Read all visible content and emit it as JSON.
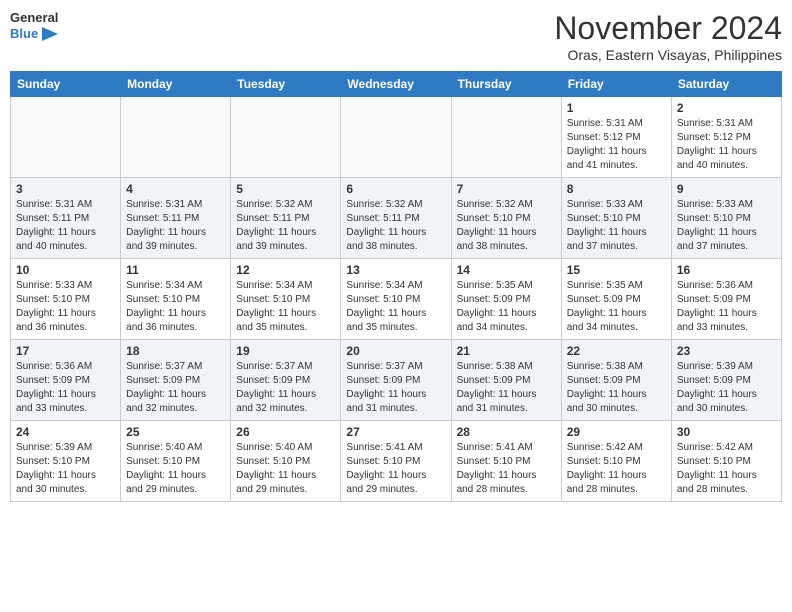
{
  "header": {
    "logo_line1": "General",
    "logo_line2": "Blue",
    "title": "November 2024",
    "subtitle": "Oras, Eastern Visayas, Philippines"
  },
  "calendar": {
    "days_of_week": [
      "Sunday",
      "Monday",
      "Tuesday",
      "Wednesday",
      "Thursday",
      "Friday",
      "Saturday"
    ],
    "weeks": [
      {
        "alt": false,
        "days": [
          {
            "num": "",
            "info": ""
          },
          {
            "num": "",
            "info": ""
          },
          {
            "num": "",
            "info": ""
          },
          {
            "num": "",
            "info": ""
          },
          {
            "num": "",
            "info": ""
          },
          {
            "num": "1",
            "info": "Sunrise: 5:31 AM\nSunset: 5:12 PM\nDaylight: 11 hours\nand 41 minutes."
          },
          {
            "num": "2",
            "info": "Sunrise: 5:31 AM\nSunset: 5:12 PM\nDaylight: 11 hours\nand 40 minutes."
          }
        ]
      },
      {
        "alt": true,
        "days": [
          {
            "num": "3",
            "info": "Sunrise: 5:31 AM\nSunset: 5:11 PM\nDaylight: 11 hours\nand 40 minutes."
          },
          {
            "num": "4",
            "info": "Sunrise: 5:31 AM\nSunset: 5:11 PM\nDaylight: 11 hours\nand 39 minutes."
          },
          {
            "num": "5",
            "info": "Sunrise: 5:32 AM\nSunset: 5:11 PM\nDaylight: 11 hours\nand 39 minutes."
          },
          {
            "num": "6",
            "info": "Sunrise: 5:32 AM\nSunset: 5:11 PM\nDaylight: 11 hours\nand 38 minutes."
          },
          {
            "num": "7",
            "info": "Sunrise: 5:32 AM\nSunset: 5:10 PM\nDaylight: 11 hours\nand 38 minutes."
          },
          {
            "num": "8",
            "info": "Sunrise: 5:33 AM\nSunset: 5:10 PM\nDaylight: 11 hours\nand 37 minutes."
          },
          {
            "num": "9",
            "info": "Sunrise: 5:33 AM\nSunset: 5:10 PM\nDaylight: 11 hours\nand 37 minutes."
          }
        ]
      },
      {
        "alt": false,
        "days": [
          {
            "num": "10",
            "info": "Sunrise: 5:33 AM\nSunset: 5:10 PM\nDaylight: 11 hours\nand 36 minutes."
          },
          {
            "num": "11",
            "info": "Sunrise: 5:34 AM\nSunset: 5:10 PM\nDaylight: 11 hours\nand 36 minutes."
          },
          {
            "num": "12",
            "info": "Sunrise: 5:34 AM\nSunset: 5:10 PM\nDaylight: 11 hours\nand 35 minutes."
          },
          {
            "num": "13",
            "info": "Sunrise: 5:34 AM\nSunset: 5:10 PM\nDaylight: 11 hours\nand 35 minutes."
          },
          {
            "num": "14",
            "info": "Sunrise: 5:35 AM\nSunset: 5:09 PM\nDaylight: 11 hours\nand 34 minutes."
          },
          {
            "num": "15",
            "info": "Sunrise: 5:35 AM\nSunset: 5:09 PM\nDaylight: 11 hours\nand 34 minutes."
          },
          {
            "num": "16",
            "info": "Sunrise: 5:36 AM\nSunset: 5:09 PM\nDaylight: 11 hours\nand 33 minutes."
          }
        ]
      },
      {
        "alt": true,
        "days": [
          {
            "num": "17",
            "info": "Sunrise: 5:36 AM\nSunset: 5:09 PM\nDaylight: 11 hours\nand 33 minutes."
          },
          {
            "num": "18",
            "info": "Sunrise: 5:37 AM\nSunset: 5:09 PM\nDaylight: 11 hours\nand 32 minutes."
          },
          {
            "num": "19",
            "info": "Sunrise: 5:37 AM\nSunset: 5:09 PM\nDaylight: 11 hours\nand 32 minutes."
          },
          {
            "num": "20",
            "info": "Sunrise: 5:37 AM\nSunset: 5:09 PM\nDaylight: 11 hours\nand 31 minutes."
          },
          {
            "num": "21",
            "info": "Sunrise: 5:38 AM\nSunset: 5:09 PM\nDaylight: 11 hours\nand 31 minutes."
          },
          {
            "num": "22",
            "info": "Sunrise: 5:38 AM\nSunset: 5:09 PM\nDaylight: 11 hours\nand 30 minutes."
          },
          {
            "num": "23",
            "info": "Sunrise: 5:39 AM\nSunset: 5:09 PM\nDaylight: 11 hours\nand 30 minutes."
          }
        ]
      },
      {
        "alt": false,
        "days": [
          {
            "num": "24",
            "info": "Sunrise: 5:39 AM\nSunset: 5:10 PM\nDaylight: 11 hours\nand 30 minutes."
          },
          {
            "num": "25",
            "info": "Sunrise: 5:40 AM\nSunset: 5:10 PM\nDaylight: 11 hours\nand 29 minutes."
          },
          {
            "num": "26",
            "info": "Sunrise: 5:40 AM\nSunset: 5:10 PM\nDaylight: 11 hours\nand 29 minutes."
          },
          {
            "num": "27",
            "info": "Sunrise: 5:41 AM\nSunset: 5:10 PM\nDaylight: 11 hours\nand 29 minutes."
          },
          {
            "num": "28",
            "info": "Sunrise: 5:41 AM\nSunset: 5:10 PM\nDaylight: 11 hours\nand 28 minutes."
          },
          {
            "num": "29",
            "info": "Sunrise: 5:42 AM\nSunset: 5:10 PM\nDaylight: 11 hours\nand 28 minutes."
          },
          {
            "num": "30",
            "info": "Sunrise: 5:42 AM\nSunset: 5:10 PM\nDaylight: 11 hours\nand 28 minutes."
          }
        ]
      }
    ]
  }
}
